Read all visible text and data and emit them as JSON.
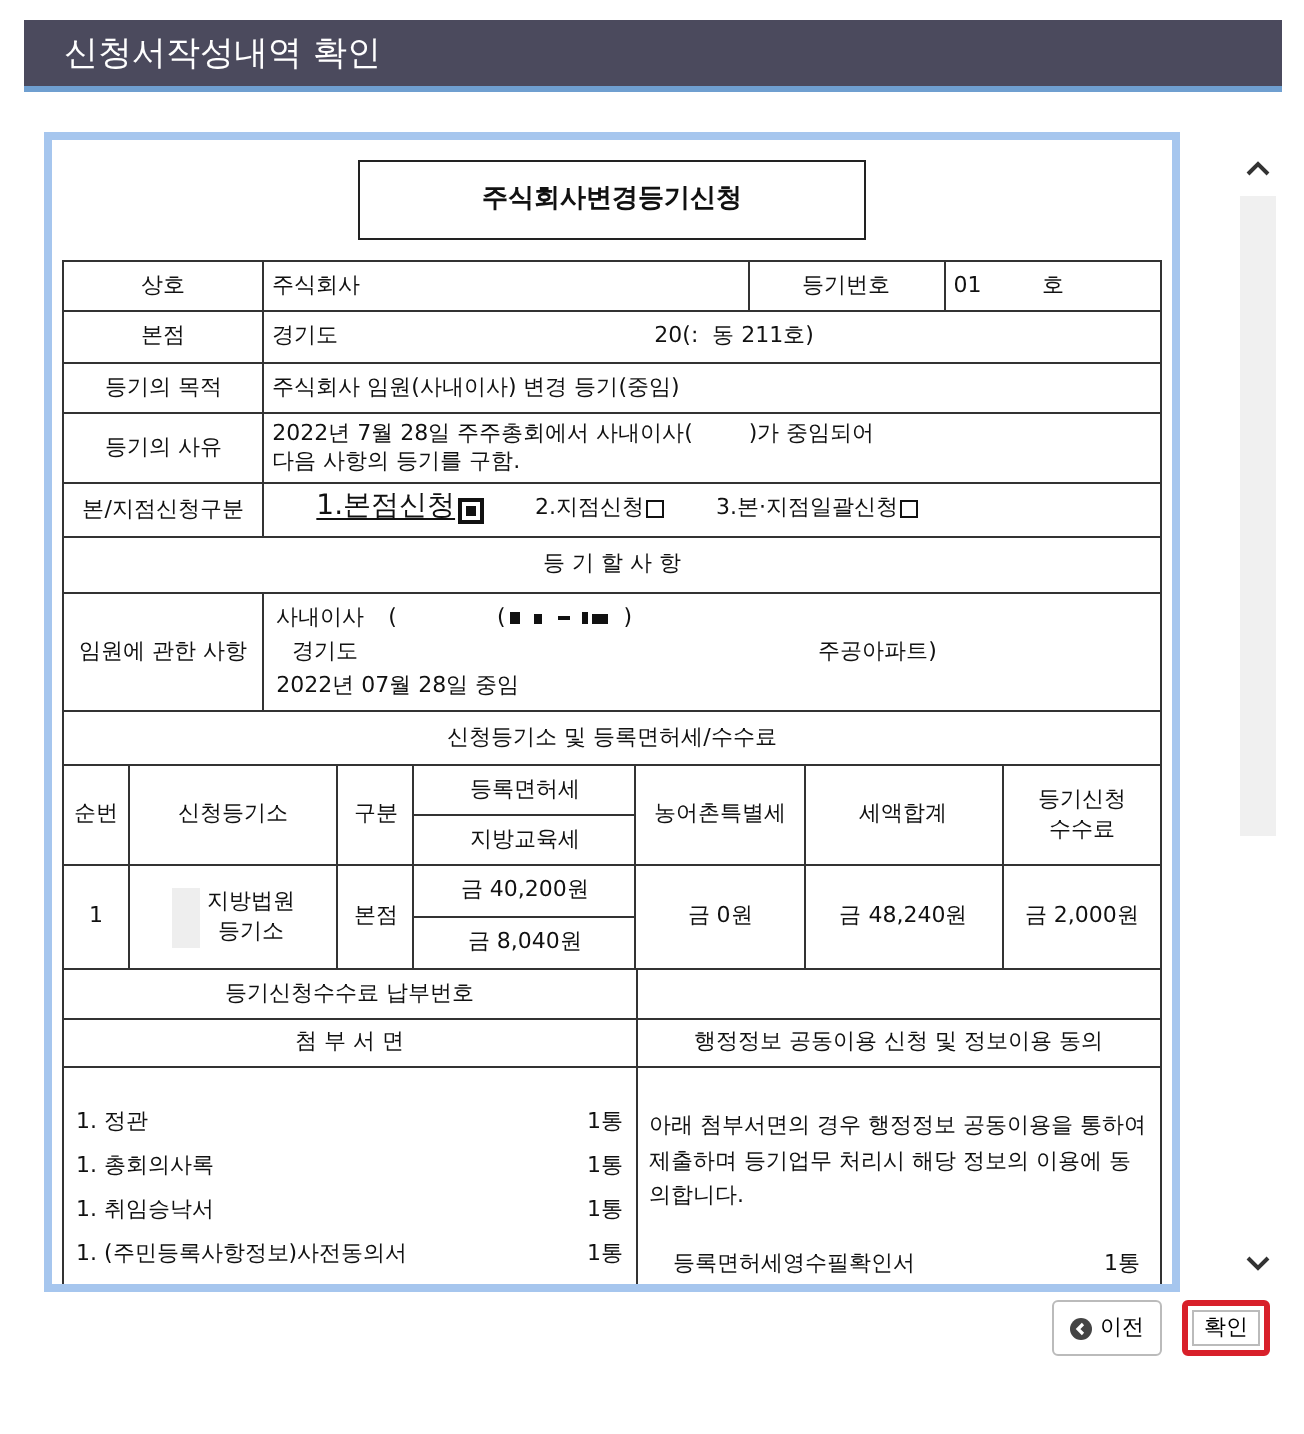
{
  "page_title": "신청서작성내역 확인",
  "document": {
    "title": "주식회사변경등기신청",
    "company": {
      "label": "상호",
      "value": "주식회사"
    },
    "registry_number": {
      "label": "등기번호",
      "value": "01",
      "suffix": "호"
    },
    "head_office": {
      "label": "본점",
      "region": "경기도",
      "address": "20(:  동 211호)"
    },
    "purpose": {
      "label": "등기의 목적",
      "value": "주식회사 임원(사내이사) 변경 등기(중임)"
    },
    "cause": {
      "label": "등기의 사유",
      "lines": [
        "2022년 7월 28일 주주총회에서 사내이사(        )가 중임되어",
        "다음 사항의 등기를 구함."
      ]
    },
    "application_type": {
      "label": "본/지점신청구분",
      "options": [
        {
          "label": "1.본점신청",
          "checked": true
        },
        {
          "label": "2.지점신청",
          "checked": false
        },
        {
          "label": "3.본·지점일괄신청",
          "checked": false
        }
      ]
    },
    "registration_heading": "등 기 할 사 항",
    "officer": {
      "label": "임원에 관한 사항",
      "role": "사내이사",
      "open_paren": "(",
      "id_open": "(",
      "id_close": ")",
      "region": "경기도",
      "apartment": "주공아파트)",
      "date_line": "2022년 07월 28일 중임"
    },
    "fees": {
      "heading": "신청등기소 및 등록면허세/수수료",
      "columns": {
        "no": "순번",
        "office": "신청등기소",
        "type": "구분",
        "license_tax": "등록면허세",
        "education_tax": "지방교육세",
        "rural_tax": "농어촌특별세",
        "total": "세액합계",
        "fee": [
          "등기신청",
          "수수료"
        ]
      },
      "rows": [
        {
          "no": "1",
          "office": [
            "지방법원",
            "등기소"
          ],
          "type": "본점",
          "license_tax": "금  40,200원",
          "education_tax": "금  8,040원",
          "rural_tax": "금  0원",
          "total": "금  48,240원",
          "fee": "금  2,000원"
        }
      ]
    },
    "fee_payment_label": "등기신청수수료 납부번호",
    "attachments": {
      "heading": "첨 부 서 면",
      "items": [
        {
          "name": "1. 정관",
          "count": "1통"
        },
        {
          "name": "1. 총회의사록",
          "count": "1통"
        },
        {
          "name": "1. 취임승낙서",
          "count": "1통"
        },
        {
          "name": "1. (주민등록사항정보)사전동의서",
          "count": "1통"
        }
      ]
    },
    "consent": {
      "heading": "행정정보 공동이용 신청 및 정보이용 동의",
      "text": "아래 첨부서면의 경우 행정정보 공동이용을 통하여 제출하며 등기업무 처리시 해당 정보의 이용에 동의합니다.",
      "items": [
        {
          "name": "등록면허세영수필확인서",
          "count": "1통"
        }
      ]
    }
  },
  "buttons": [
    {
      "kind": "prev",
      "label": "이전",
      "highlighted": false
    },
    {
      "kind": "confirm",
      "label": "확인",
      "highlighted": true
    }
  ]
}
